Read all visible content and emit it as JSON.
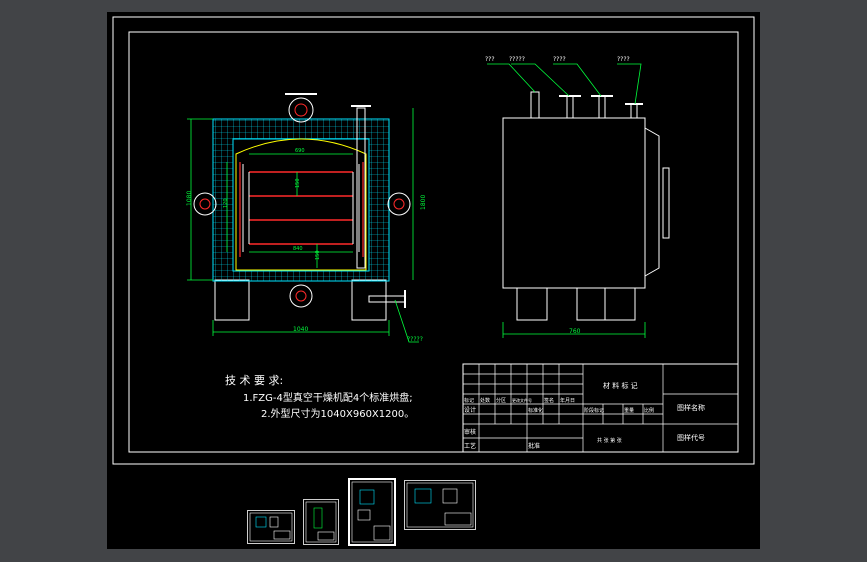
{
  "colors": {
    "background": "#424447",
    "canvas": "#000000",
    "frame": "#ffffff",
    "green": "#00ff3c",
    "cyan": "#00e5ff",
    "yellow": "#ffff00",
    "red": "#ff2a2a",
    "outline": "#ffffff"
  },
  "front_view": {
    "dim_690": "690",
    "dim_840": "840",
    "dim_1040": "1040",
    "dim_1080": "1080",
    "dim_1800": "1800",
    "dim_150a": "150",
    "dim_150b": "150",
    "dim_120": "120",
    "callout": "?????"
  },
  "side_view": {
    "labels": [
      "???",
      "?????",
      "????",
      "????"
    ],
    "dim_760": "760"
  },
  "notes": {
    "heading": "技 术 要 求:",
    "line1": "1.FZG-4型真空干燥机配4个标准烘盘;",
    "line2": "2.外型尺寸为1040X960X1200。"
  },
  "title_block": {
    "material_mark": "材 料 标 记",
    "drawing_name": "图样名称",
    "drawing_code": "图样代号",
    "row1": [
      "标记",
      "处数",
      "分区",
      "更改文件号",
      "签名",
      "年月日"
    ],
    "row2": [
      "设计",
      "标准化",
      "阶段标记",
      "重量",
      "比例"
    ],
    "review": "审核",
    "process": "工艺",
    "approve": "批准",
    "sheet": "共  张  第  张"
  },
  "thumbnails": [
    {
      "name": "thumb-1"
    },
    {
      "name": "thumb-2"
    },
    {
      "name": "thumb-3"
    },
    {
      "name": "thumb-4"
    }
  ]
}
